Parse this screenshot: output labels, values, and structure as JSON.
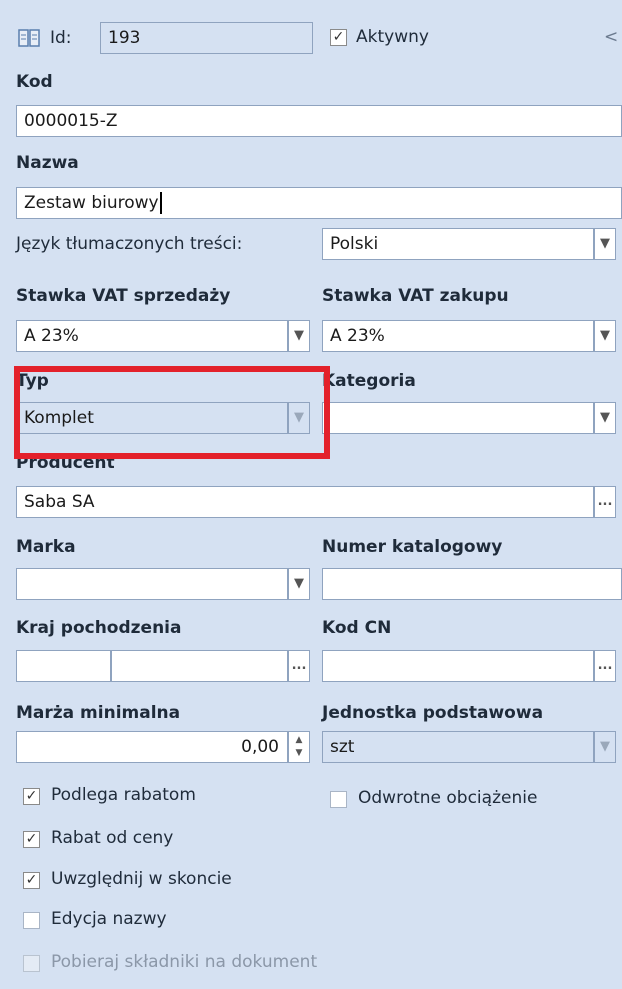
{
  "header": {
    "id_label": "Id:",
    "id_value": "193",
    "active_label": "Aktywny",
    "active_checked": true,
    "collapse_glyph": "<"
  },
  "fields": {
    "kod": {
      "label": "Kod",
      "value": "0000015-Z"
    },
    "nazwa": {
      "label": "Nazwa",
      "value": "Zestaw biurowy"
    },
    "jezyk": {
      "label": "Język tłumaczonych treści:",
      "value": "Polski"
    },
    "vat_sprzedazy": {
      "label": "Stawka VAT sprzedaży",
      "value": "A 23%"
    },
    "vat_zakupu": {
      "label": "Stawka VAT zakupu",
      "value": "A 23%"
    },
    "typ": {
      "label": "Typ",
      "value": "Komplet"
    },
    "kategoria": {
      "label": "Kategoria",
      "value": ""
    },
    "producent": {
      "label": "Producent",
      "value": "Saba SA"
    },
    "marka": {
      "label": "Marka",
      "value": ""
    },
    "numer_katalogowy": {
      "label": "Numer katalogowy",
      "value": ""
    },
    "kraj_pochodzenia": {
      "label": "Kraj pochodzenia",
      "code": "",
      "name": ""
    },
    "kod_cn": {
      "label": "Kod CN",
      "value": ""
    },
    "marza_minimalna": {
      "label": "Marża minimalna",
      "value": "0,00"
    },
    "jednostka_podstawowa": {
      "label": "Jednostka podstawowa",
      "value": "szt"
    }
  },
  "checkboxes": {
    "podlega_rabatom": {
      "label": "Podlega rabatom",
      "checked": true
    },
    "odwrotne_obciazenie": {
      "label": "Odwrotne obciążenie",
      "checked": false
    },
    "rabat_od_ceny": {
      "label": "Rabat od ceny",
      "checked": true
    },
    "uwzglednij_w_skoncie": {
      "label": "Uwzględnij w skoncie",
      "checked": true
    },
    "edycja_nazwy": {
      "label": "Edycja nazwy",
      "checked": false
    },
    "pobieraj_skladniki": {
      "label": "Pobieraj składniki na dokument",
      "checked": false
    }
  },
  "glyphs": {
    "dropdown": "▼",
    "ellipsis": "...",
    "check": "✓",
    "spin_up": "▲",
    "spin_down": "▼"
  },
  "colors": {
    "background": "#d5e1f2",
    "highlight": "#e3212b",
    "border": "#8fa3bf"
  }
}
